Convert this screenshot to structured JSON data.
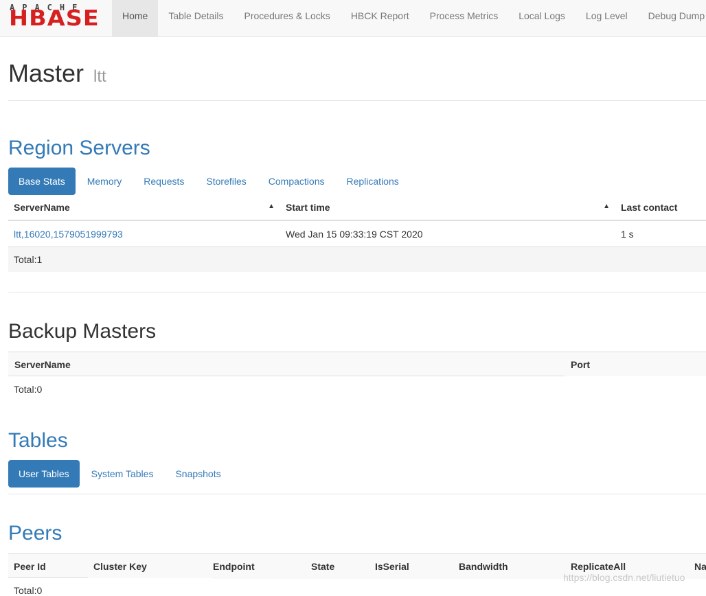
{
  "logo": {
    "top": "APACHE",
    "name": "HBASE"
  },
  "nav": [
    "Home",
    "Table Details",
    "Procedures & Locks",
    "HBCK Report",
    "Process Metrics",
    "Local Logs",
    "Log Level",
    "Debug Dump"
  ],
  "page": {
    "title": "Master",
    "host": "ltt"
  },
  "region_servers": {
    "title": "Region Servers",
    "tabs": [
      "Base Stats",
      "Memory",
      "Requests",
      "Storefiles",
      "Compactions",
      "Replications"
    ],
    "columns": [
      "ServerName",
      "Start time",
      "Last contact"
    ],
    "rows": [
      {
        "server": "ltt,16020,1579051999793",
        "start": "Wed Jan 15 09:33:19 CST 2020",
        "contact": "1 s"
      }
    ],
    "total": "Total:1"
  },
  "backup_masters": {
    "title": "Backup Masters",
    "columns": [
      "ServerName",
      "Port"
    ],
    "total": "Total:0"
  },
  "tables": {
    "title": "Tables",
    "tabs": [
      "User Tables",
      "System Tables",
      "Snapshots"
    ]
  },
  "peers": {
    "title": "Peers",
    "columns": [
      "Peer Id",
      "Cluster Key",
      "Endpoint",
      "State",
      "IsSerial",
      "Bandwidth",
      "ReplicateAll",
      "Na"
    ],
    "total": "Total:0"
  },
  "watermark": "https://blog.csdn.net/liutietuo"
}
